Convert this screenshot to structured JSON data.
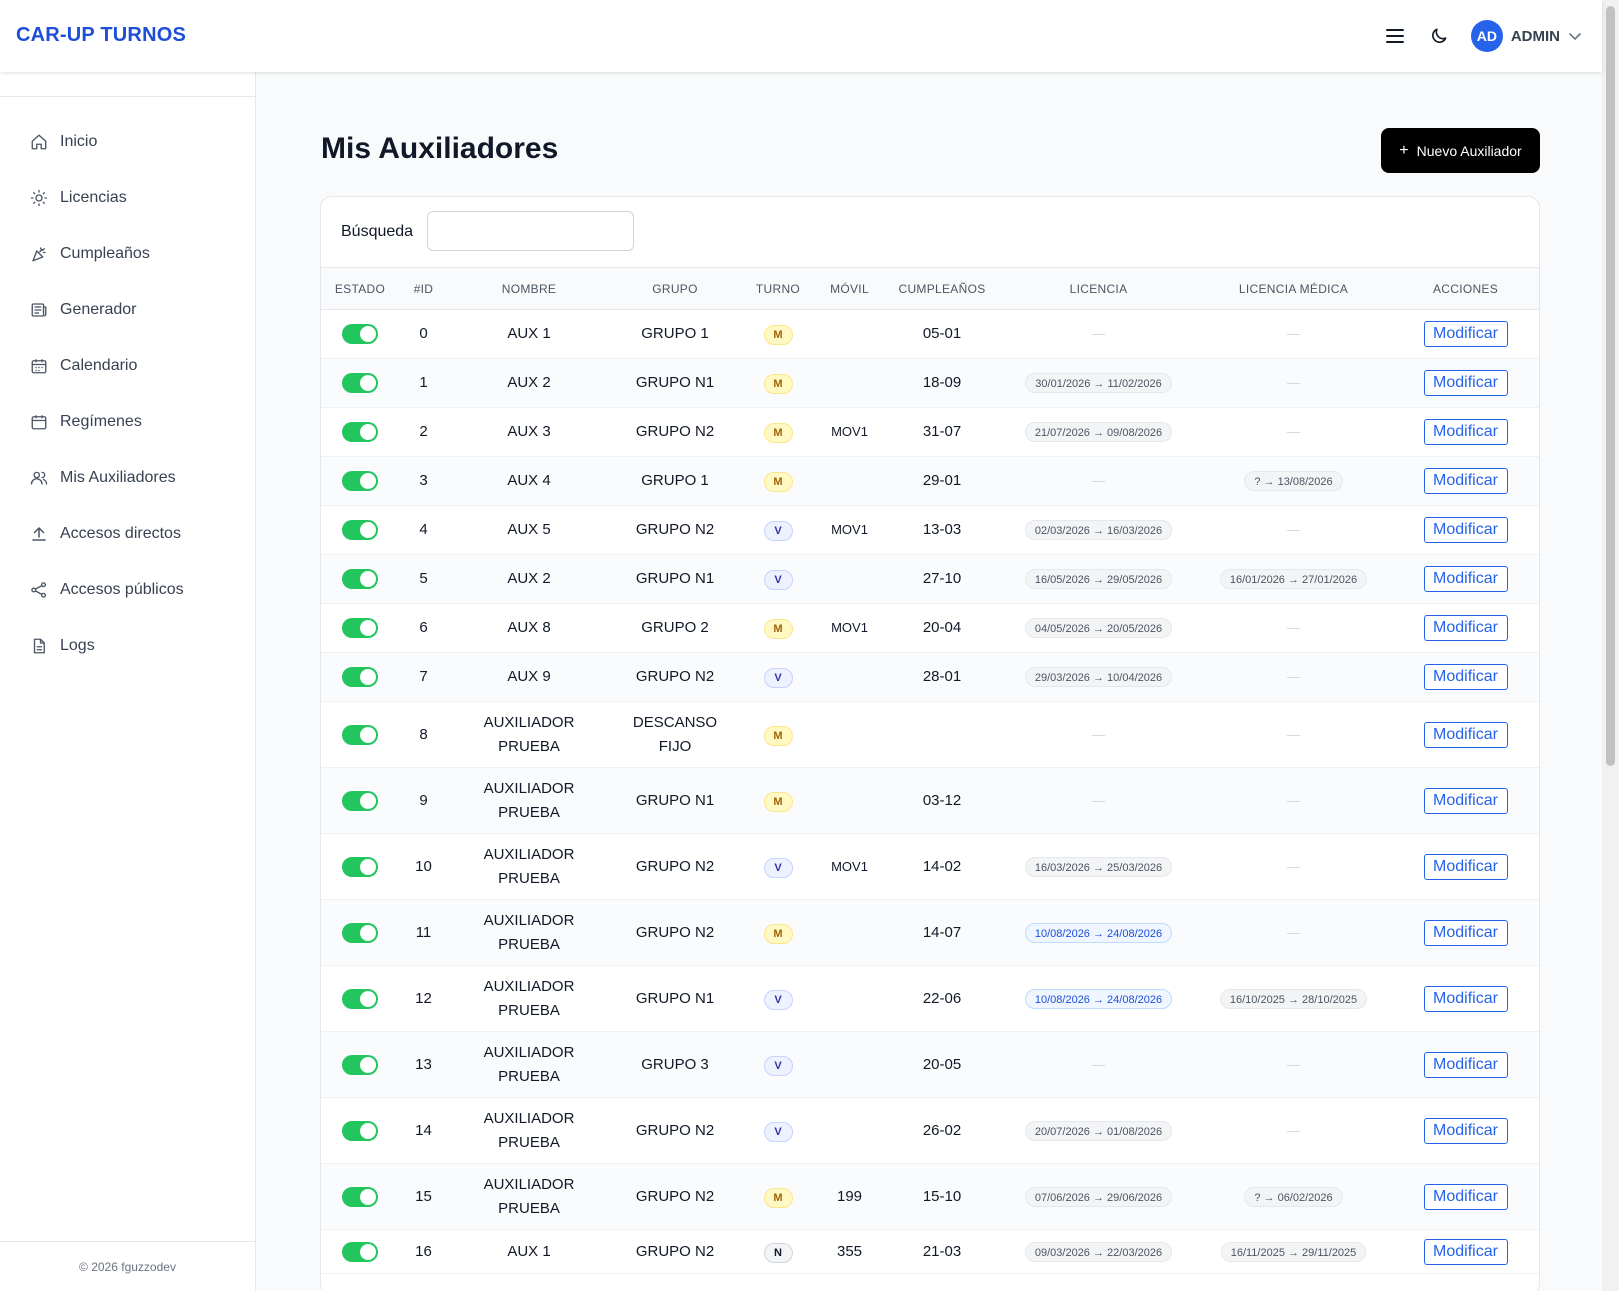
{
  "app": {
    "title": "CAR-UP TURNOS"
  },
  "header": {
    "avatar": "AD",
    "user": "ADMIN"
  },
  "sidebar": {
    "items": [
      {
        "label": "Inicio",
        "icon": "home-icon"
      },
      {
        "label": "Licencias",
        "icon": "sun-icon"
      },
      {
        "label": "Cumpleaños",
        "icon": "party-icon"
      },
      {
        "label": "Generador",
        "icon": "newspaper-icon"
      },
      {
        "label": "Calendario",
        "icon": "calendar-days-icon"
      },
      {
        "label": "Regímenes",
        "icon": "calendar-icon"
      },
      {
        "label": "Mis Auxiliadores",
        "icon": "users-icon"
      },
      {
        "label": "Accesos directos",
        "icon": "upload-icon"
      },
      {
        "label": "Accesos públicos",
        "icon": "share-icon"
      },
      {
        "label": "Logs",
        "icon": "document-icon"
      }
    ],
    "footer": "© 2026 fguzzodev"
  },
  "main": {
    "title": "Mis Auxiliadores",
    "new_button": "Nuevo Auxiliador",
    "search": {
      "label": "Búsqueda",
      "value": "",
      "placeholder": ""
    },
    "columns": [
      "ESTADO",
      "#ID",
      "NOMBRE",
      "GRUPO",
      "TURNO",
      "MÓVIL",
      "CUMPLEAÑOS",
      "LICENCIA",
      "LICENCIA MÉDICA",
      "ACCIONES"
    ],
    "action_label": "Modificar",
    "empty_mark": "—",
    "rows": [
      {
        "active": true,
        "id": "0",
        "name": "AUX 1",
        "group": "GRUPO 1",
        "turno": "M",
        "movil": "",
        "birthday": "05-01",
        "licencia": "",
        "lic_style": "gray",
        "medica": ""
      },
      {
        "active": true,
        "id": "1",
        "name": "AUX 2",
        "group": "GRUPO N1",
        "turno": "M",
        "movil": "",
        "birthday": "18-09",
        "licencia": "30/01/2026 → 11/02/2026",
        "lic_style": "gray",
        "medica": ""
      },
      {
        "active": true,
        "id": "2",
        "name": "AUX 3",
        "group": "GRUPO N2",
        "turno": "M",
        "movil": "MOV1",
        "birthday": "31-07",
        "licencia": "21/07/2026 → 09/08/2026",
        "lic_style": "gray",
        "medica": ""
      },
      {
        "active": true,
        "id": "3",
        "name": "AUX 4",
        "group": "GRUPO 1",
        "turno": "M",
        "movil": "",
        "birthday": "29-01",
        "licencia": "",
        "lic_style": "gray",
        "medica": "? → 13/08/2026"
      },
      {
        "active": true,
        "id": "4",
        "name": "AUX 5",
        "group": "GRUPO N2",
        "turno": "V",
        "movil": "MOV1",
        "birthday": "13-03",
        "licencia": "02/03/2026 → 16/03/2026",
        "lic_style": "gray",
        "medica": ""
      },
      {
        "active": true,
        "id": "5",
        "name": "AUX 2",
        "group": "GRUPO N1",
        "turno": "V",
        "movil": "",
        "birthday": "27-10",
        "licencia": "16/05/2026 → 29/05/2026",
        "lic_style": "gray",
        "medica": "16/01/2026 → 27/01/2026"
      },
      {
        "active": true,
        "id": "6",
        "name": "AUX 8",
        "group": "GRUPO 2",
        "turno": "M",
        "movil": "MOV1",
        "birthday": "20-04",
        "licencia": "04/05/2026 → 20/05/2026",
        "lic_style": "gray",
        "medica": ""
      },
      {
        "active": true,
        "id": "7",
        "name": "AUX 9",
        "group": "GRUPO N2",
        "turno": "V",
        "movil": "",
        "birthday": "28-01",
        "licencia": "29/03/2026 → 10/04/2026",
        "lic_style": "gray",
        "medica": ""
      },
      {
        "active": true,
        "id": "8",
        "name": "AUXILIADOR PRUEBA",
        "group": "DESCANSO FIJO",
        "turno": "M",
        "movil": "",
        "birthday": "",
        "licencia": "",
        "lic_style": "gray",
        "medica": ""
      },
      {
        "active": true,
        "id": "9",
        "name": "AUXILIADOR PRUEBA",
        "group": "GRUPO N1",
        "turno": "M",
        "movil": "",
        "birthday": "03-12",
        "licencia": "",
        "lic_style": "gray",
        "medica": ""
      },
      {
        "active": true,
        "id": "10",
        "name": "AUXILIADOR PRUEBA",
        "group": "GRUPO N2",
        "turno": "V",
        "movil": "MOV1",
        "birthday": "14-02",
        "licencia": "16/03/2026 → 25/03/2026",
        "lic_style": "gray",
        "medica": ""
      },
      {
        "active": true,
        "id": "11",
        "name": "AUXILIADOR PRUEBA",
        "group": "GRUPO N2",
        "turno": "M",
        "movil": "",
        "birthday": "14-07",
        "licencia": "10/08/2026 → 24/08/2026",
        "lic_style": "blue",
        "medica": ""
      },
      {
        "active": true,
        "id": "12",
        "name": "AUXILIADOR PRUEBA",
        "group": "GRUPO N1",
        "turno": "V",
        "movil": "",
        "birthday": "22-06",
        "licencia": "10/08/2026 → 24/08/2026",
        "lic_style": "blue",
        "medica": "16/10/2025 → 28/10/2025"
      },
      {
        "active": true,
        "id": "13",
        "name": "AUXILIADOR PRUEBA",
        "group": "GRUPO 3",
        "turno": "V",
        "movil": "",
        "birthday": "20-05",
        "licencia": "",
        "lic_style": "gray",
        "medica": ""
      },
      {
        "active": true,
        "id": "14",
        "name": "AUXILIADOR PRUEBA",
        "group": "GRUPO N2",
        "turno": "V",
        "movil": "",
        "birthday": "26-02",
        "licencia": "20/07/2026 → 01/08/2026",
        "lic_style": "gray",
        "medica": ""
      },
      {
        "active": true,
        "id": "15",
        "name": "AUXILIADOR PRUEBA",
        "group": "GRUPO N2",
        "turno": "M",
        "movil": "199",
        "birthday": "15-10",
        "licencia": "07/06/2026 → 29/06/2026",
        "lic_style": "gray",
        "medica": "? → 06/02/2026"
      },
      {
        "active": true,
        "id": "16",
        "name": "AUX 1",
        "group": "GRUPO N2",
        "turno": "N",
        "movil": "355",
        "birthday": "21-03",
        "licencia": "09/03/2026 → 22/03/2026",
        "lic_style": "gray",
        "medica": "16/11/2025 → 29/11/2025"
      }
    ]
  },
  "colors": {
    "brand": "#1d4ed8",
    "toggle_on": "#22c55e",
    "action": "#2563eb",
    "primary_button": "#000000"
  }
}
